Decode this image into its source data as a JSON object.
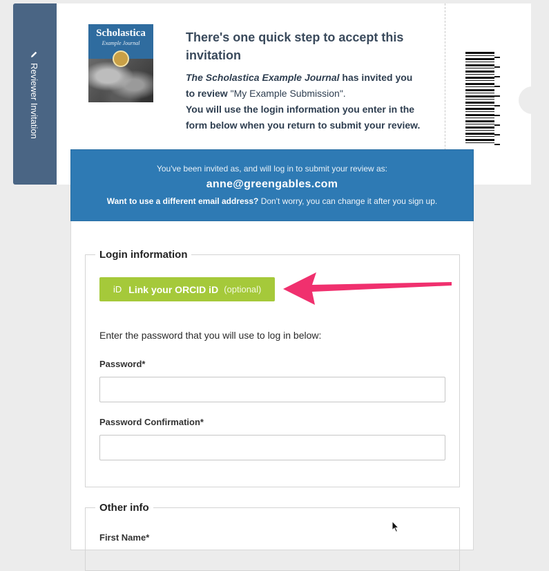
{
  "ticket": {
    "tab_label": "Reviewer Invitation",
    "cover": {
      "title": "Scholastica",
      "subtitle": "Example Journal"
    },
    "heading": "There's one quick step to accept this invitation",
    "journal_name": "The Scholastica Example Journal",
    "invited_text": " has invited you to review ",
    "submission_title": "\"My Example Submission\".",
    "login_note": "You will use the login information you enter in the form below when you return to submit your review."
  },
  "panel_header": {
    "line1": "You've been invited as, and will log in to submit your review as:",
    "email": "anne@greengables.com",
    "line3_bold": "Want to use a different email address?",
    "line3_rest": " Don't worry, you can change it after you sign up."
  },
  "login_section": {
    "legend": "Login information",
    "orcid_icon_text": "iD",
    "orcid_button": "Link your ORCID iD",
    "orcid_optional": "(optional)",
    "help_text": "Enter the password that you will use to log in below:",
    "password_label": "Password*",
    "password_value": "",
    "password_confirmation_label": "Password Confirmation*",
    "password_confirmation_value": ""
  },
  "other_section": {
    "legend": "Other info",
    "first_name_label": "First Name*"
  },
  "colors": {
    "tab": "#4a6584",
    "header": "#2e7ab4",
    "orcid": "#a5c93a",
    "arrow": "#f0306e"
  }
}
